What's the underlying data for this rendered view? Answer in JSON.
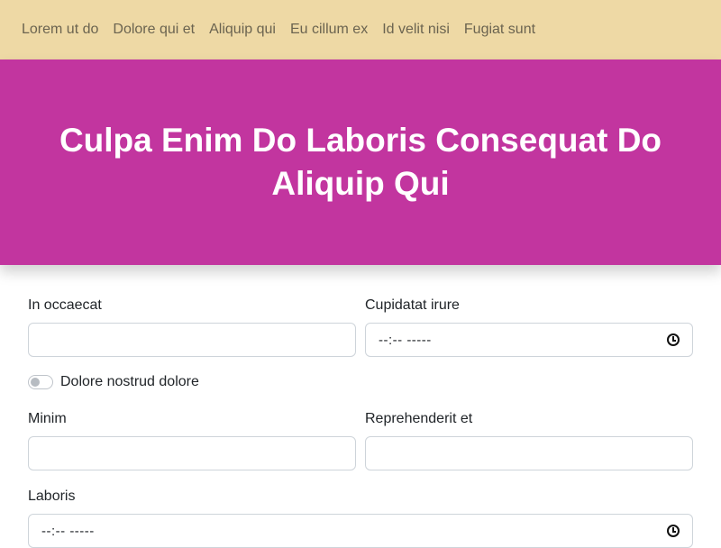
{
  "nav": {
    "items": [
      {
        "label": "Lorem ut do"
      },
      {
        "label": "Dolore qui et"
      },
      {
        "label": "Aliquip qui"
      },
      {
        "label": "Eu cillum ex"
      },
      {
        "label": "Id velit nisi"
      },
      {
        "label": "Fugiat sunt"
      }
    ]
  },
  "hero": {
    "title": "Culpa Enim Do Laboris Consequat Do Aliquip Qui",
    "background": "#c2359f"
  },
  "form": {
    "field1": {
      "label": "In occaecat",
      "value": ""
    },
    "field2": {
      "label": "Cupidatat irure",
      "value": "--:-- -----"
    },
    "toggle": {
      "label": "Dolore nostrud dolore",
      "checked": false
    },
    "field3": {
      "label": "Minim",
      "value": ""
    },
    "field4": {
      "label": "Reprehenderit et",
      "value": ""
    },
    "field5": {
      "label": "Laboris",
      "value": "--:-- -----"
    }
  },
  "colors": {
    "nav_bg": "#eed9a5",
    "hero_bg": "#c2359f",
    "border": "#ced4da"
  }
}
